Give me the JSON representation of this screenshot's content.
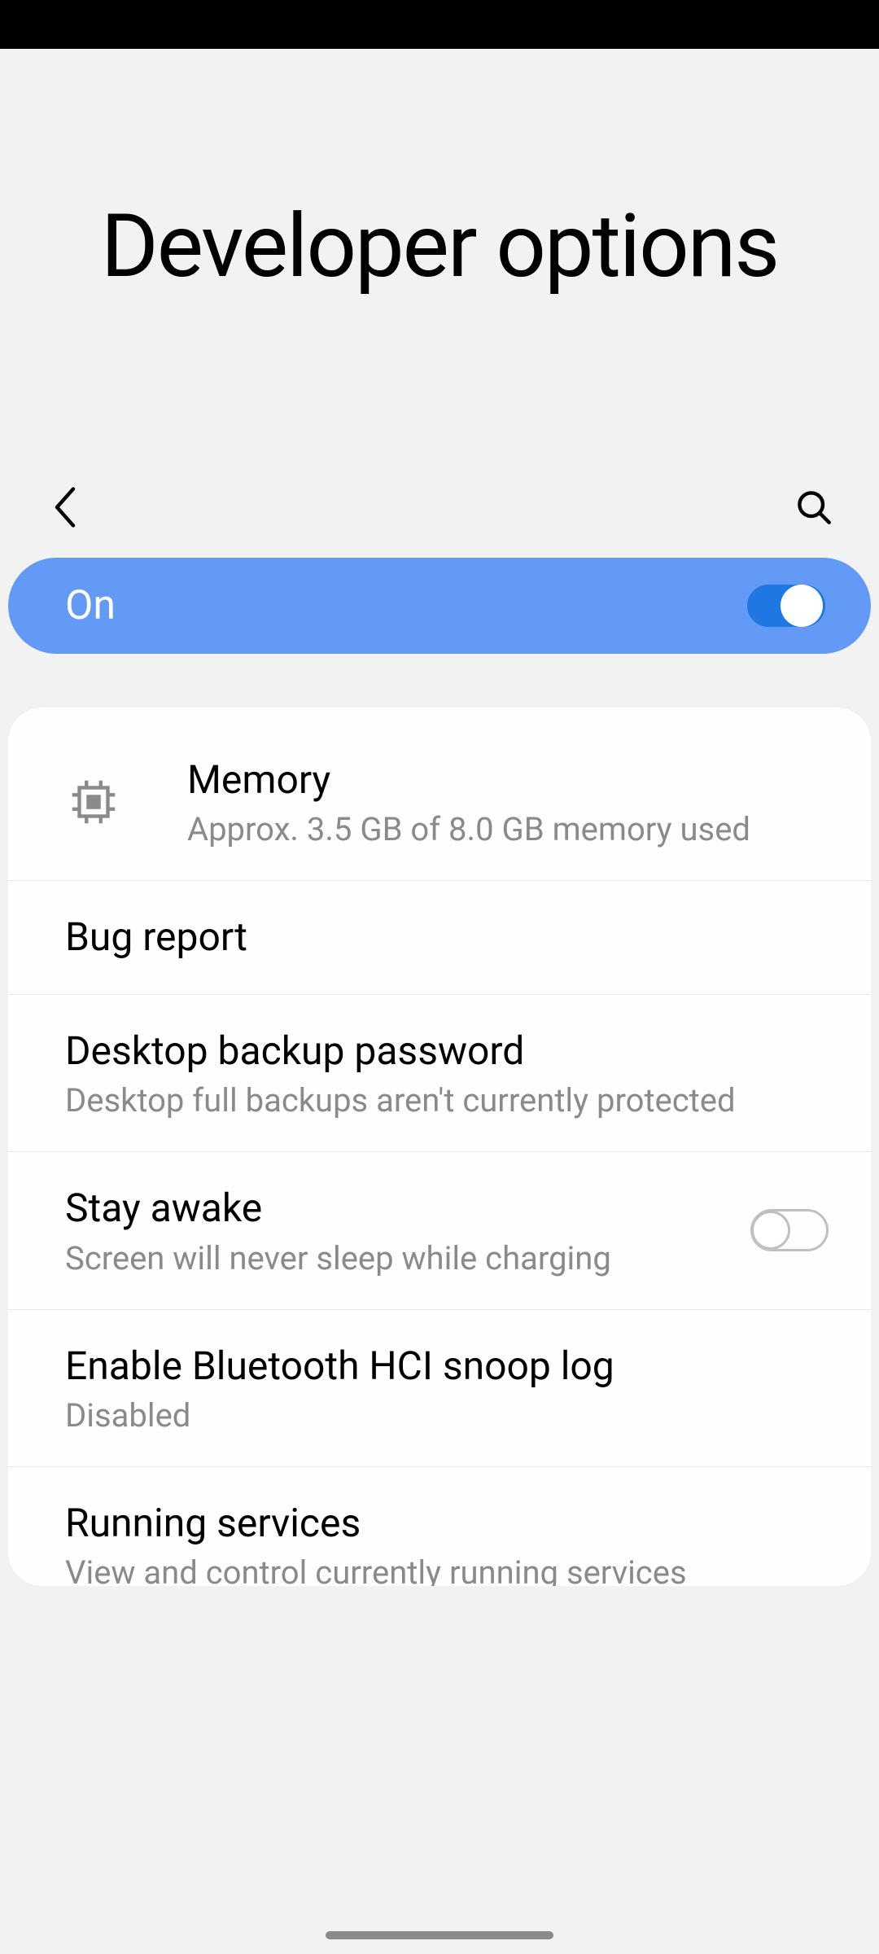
{
  "header": {
    "title": "Developer options"
  },
  "masterToggle": {
    "label": "On",
    "state": true
  },
  "rows": {
    "memory": {
      "title": "Memory",
      "subtitle": "Approx. 3.5 GB of 8.0 GB memory used"
    },
    "bugReport": {
      "title": "Bug report"
    },
    "desktopBackup": {
      "title": "Desktop backup password",
      "subtitle": "Desktop full backups aren't currently protected"
    },
    "stayAwake": {
      "title": "Stay awake",
      "subtitle": "Screen will never sleep while charging",
      "toggle": false
    },
    "bluetoothHci": {
      "title": "Enable Bluetooth HCI snoop log",
      "subtitle": "Disabled"
    },
    "runningServices": {
      "title": "Running services",
      "subtitle": "View and control currently running services"
    }
  }
}
